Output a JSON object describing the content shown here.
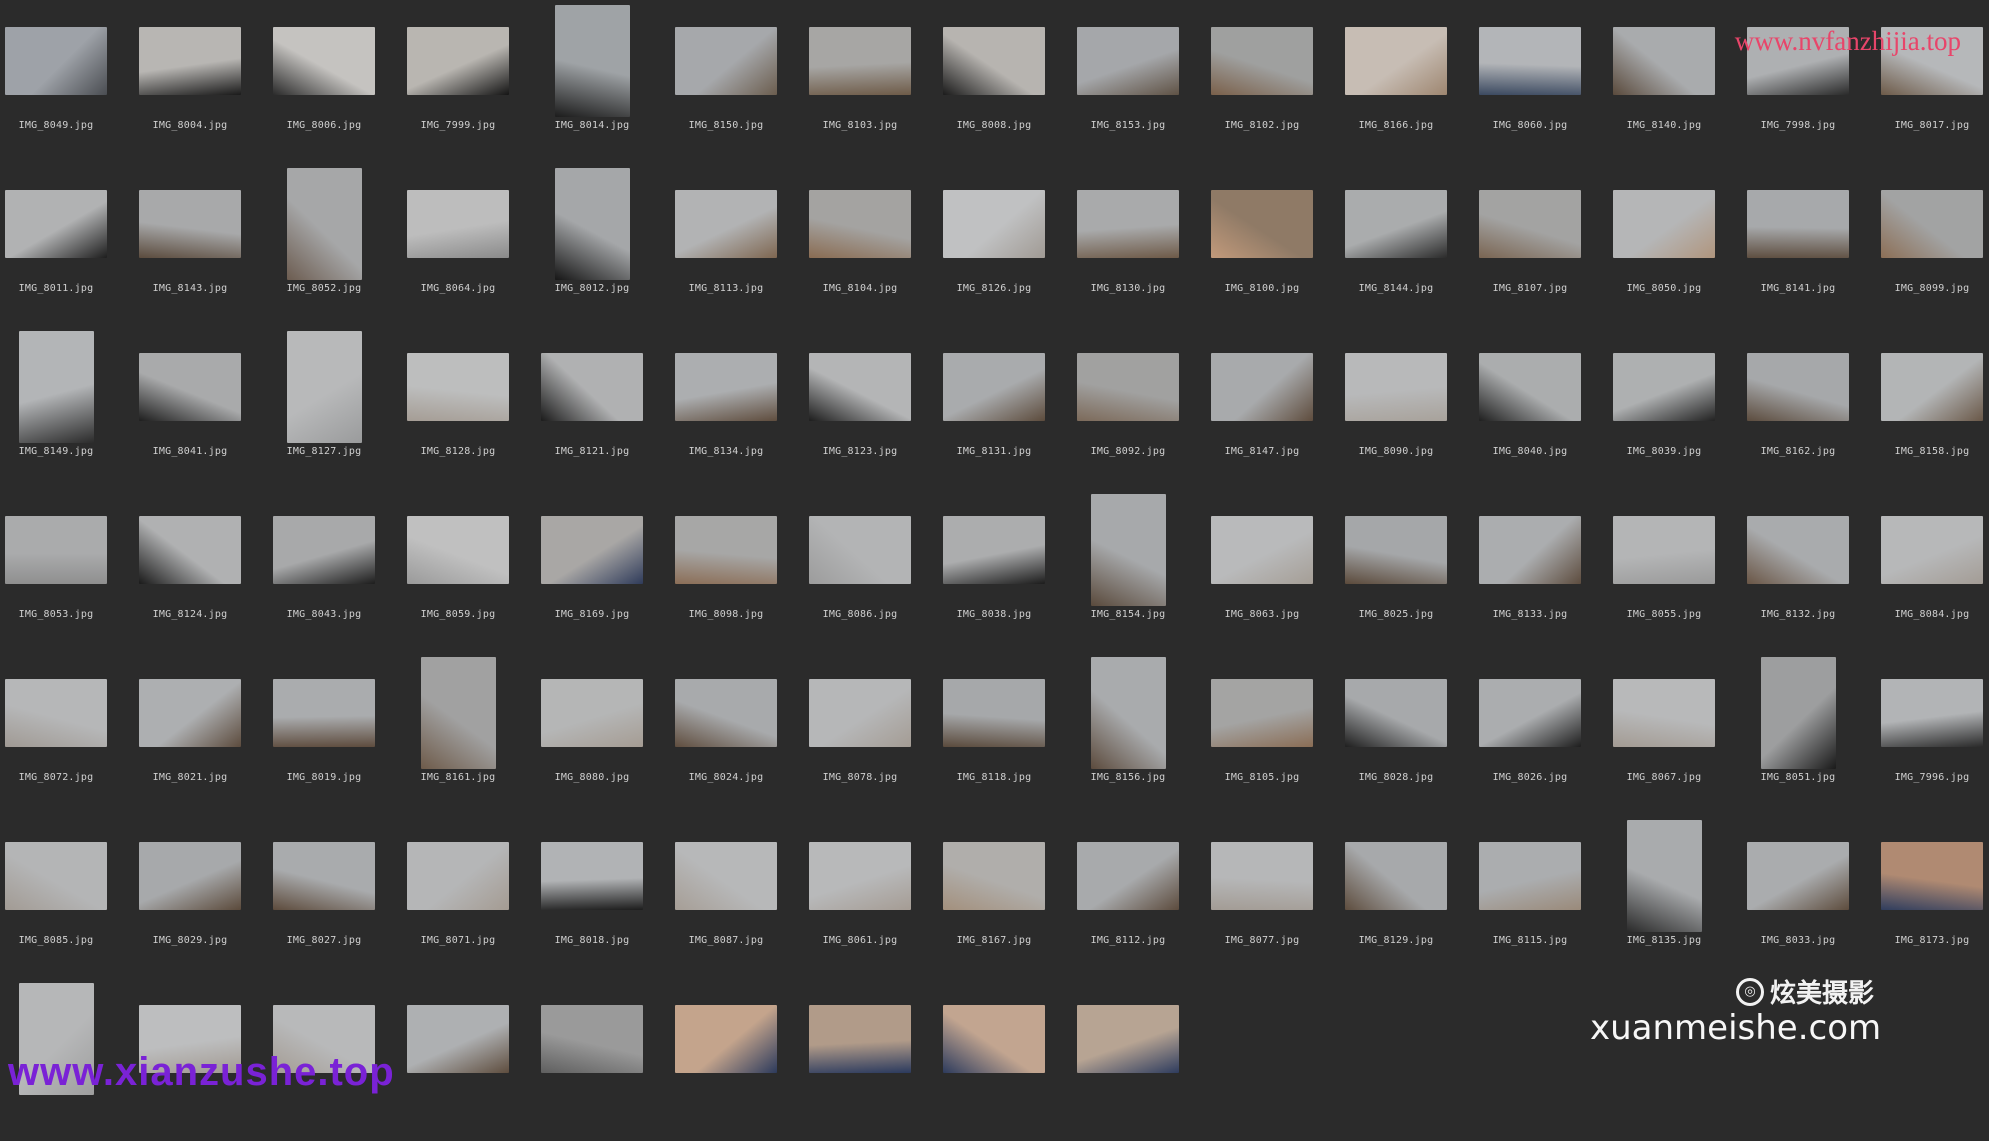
{
  "files": [
    {
      "name": "IMG_8049.jpg",
      "o": "l",
      "c": [
        "#9ea2a8",
        "#4a4d52"
      ]
    },
    {
      "name": "IMG_8004.jpg",
      "o": "l",
      "c": [
        "#b8b6b3",
        "#1a1a1a"
      ]
    },
    {
      "name": "IMG_8006.jpg",
      "o": "l",
      "c": [
        "#c5c3c0",
        "#2a2a2a"
      ]
    },
    {
      "name": "IMG_7999.jpg",
      "o": "l",
      "c": [
        "#b9b6b1",
        "#151515"
      ]
    },
    {
      "name": "IMG_8014.jpg",
      "o": "p",
      "c": [
        "#9fa3a6",
        "#1c1c1c"
      ]
    },
    {
      "name": "IMG_8150.jpg",
      "o": "l",
      "c": [
        "#a6a8ab",
        "#6b5d4e"
      ]
    },
    {
      "name": "IMG_8103.jpg",
      "o": "l",
      "c": [
        "#a7a6a4",
        "#6e5b48"
      ]
    },
    {
      "name": "IMG_8008.jpg",
      "o": "l",
      "c": [
        "#b7b4b0",
        "#1b1b1b"
      ]
    },
    {
      "name": "IMG_8153.jpg",
      "o": "l",
      "c": [
        "#a5a7aa",
        "#5f5245"
      ]
    },
    {
      "name": "IMG_8102.jpg",
      "o": "l",
      "c": [
        "#9fa09f",
        "#7a604a"
      ]
    },
    {
      "name": "IMG_8166.jpg",
      "o": "l",
      "c": [
        "#c7bdb4",
        "#9e8670"
      ]
    },
    {
      "name": "IMG_8060.jpg",
      "o": "l",
      "c": [
        "#b3b5b8",
        "#3b4960"
      ]
    },
    {
      "name": "IMG_8140.jpg",
      "o": "l",
      "c": [
        "#a9abad",
        "#5a4a3c"
      ]
    },
    {
      "name": "IMG_7998.jpg",
      "o": "l",
      "c": [
        "#aeb0b2",
        "#2a2a2a"
      ]
    },
    {
      "name": "IMG_8017.jpg",
      "o": "l",
      "c": [
        "#b6b8ba",
        "#6d5a48"
      ]
    },
    {
      "name": "IMG_8011.jpg",
      "o": "l",
      "c": [
        "#b1b2b3",
        "#1e1e1e"
      ]
    },
    {
      "name": "IMG_8143.jpg",
      "o": "l",
      "c": [
        "#a8a9aa",
        "#5b4b3d"
      ]
    },
    {
      "name": "IMG_8052.jpg",
      "o": "p",
      "c": [
        "#a6a7a8",
        "#6c5c50"
      ]
    },
    {
      "name": "IMG_8064.jpg",
      "o": "l",
      "c": [
        "#bdbdbd",
        "#8a8a8a"
      ]
    },
    {
      "name": "IMG_8012.jpg",
      "o": "p",
      "c": [
        "#a5a7a9",
        "#161616"
      ]
    },
    {
      "name": "IMG_8113.jpg",
      "o": "l",
      "c": [
        "#b2b3b4",
        "#7e6650"
      ]
    },
    {
      "name": "IMG_8104.jpg",
      "o": "l",
      "c": [
        "#a4a3a1",
        "#8a6c52"
      ]
    },
    {
      "name": "IMG_8126.jpg",
      "o": "l",
      "c": [
        "#c0c1c2",
        "#a09a94"
      ]
    },
    {
      "name": "IMG_8130.jpg",
      "o": "l",
      "c": [
        "#a9aaab",
        "#6e5a48"
      ]
    },
    {
      "name": "IMG_8100.jpg",
      "o": "l",
      "c": [
        "#8f7a66",
        "#c29a7b"
      ]
    },
    {
      "name": "IMG_8144.jpg",
      "o": "l",
      "c": [
        "#aaacad",
        "#2b2b2b"
      ]
    },
    {
      "name": "IMG_8107.jpg",
      "o": "l",
      "c": [
        "#a3a3a2",
        "#7a6552"
      ]
    },
    {
      "name": "IMG_8050.jpg",
      "o": "l",
      "c": [
        "#b5b6b7",
        "#b0957d"
      ]
    },
    {
      "name": "IMG_8141.jpg",
      "o": "l",
      "c": [
        "#a7a9ab",
        "#5e4e40"
      ]
    },
    {
      "name": "IMG_8099.jpg",
      "o": "l",
      "c": [
        "#a2a3a3",
        "#8c6f56"
      ]
    },
    {
      "name": "IMG_8149.jpg",
      "o": "p",
      "c": [
        "#b3b5b7",
        "#2b2b2b"
      ]
    },
    {
      "name": "IMG_8041.jpg",
      "o": "l",
      "c": [
        "#a9aaab",
        "#1e1e1e"
      ]
    },
    {
      "name": "IMG_8127.jpg",
      "o": "p",
      "c": [
        "#b8b9ba",
        "#9a9b9c"
      ]
    },
    {
      "name": "IMG_8128.jpg",
      "o": "l",
      "c": [
        "#bdbebe",
        "#a59d95"
      ]
    },
    {
      "name": "IMG_8121.jpg",
      "o": "l",
      "c": [
        "#b0b1b2",
        "#1b1b1b"
      ]
    },
    {
      "name": "IMG_8134.jpg",
      "o": "l",
      "c": [
        "#acaeb0",
        "#5f4d3e"
      ]
    },
    {
      "name": "IMG_8123.jpg",
      "o": "l",
      "c": [
        "#b4b5b6",
        "#1d1d1d"
      ]
    },
    {
      "name": "IMG_8131.jpg",
      "o": "l",
      "c": [
        "#a9abad",
        "#5c4b3c"
      ]
    },
    {
      "name": "IMG_8092.jpg",
      "o": "l",
      "c": [
        "#a1a1a0",
        "#7c6a5a"
      ]
    },
    {
      "name": "IMG_8147.jpg",
      "o": "l",
      "c": [
        "#a8aaac",
        "#5e4c3d"
      ]
    },
    {
      "name": "IMG_8090.jpg",
      "o": "l",
      "c": [
        "#b8b9ba",
        "#a8a29b"
      ]
    },
    {
      "name": "IMG_8040.jpg",
      "o": "l",
      "c": [
        "#abadae",
        "#1f1f1f"
      ]
    },
    {
      "name": "IMG_8039.jpg",
      "o": "l",
      "c": [
        "#aeb0b1",
        "#222222"
      ]
    },
    {
      "name": "IMG_8162.jpg",
      "o": "l",
      "c": [
        "#a6a8aa",
        "#5c4c3e"
      ]
    },
    {
      "name": "IMG_8158.jpg",
      "o": "l",
      "c": [
        "#b3b5b6",
        "#6a5848"
      ]
    },
    {
      "name": "IMG_8053.jpg",
      "o": "l",
      "c": [
        "#aaabac",
        "#8f8f8f"
      ]
    },
    {
      "name": "IMG_8124.jpg",
      "o": "l",
      "c": [
        "#b0b1b2",
        "#1a1a1a"
      ]
    },
    {
      "name": "IMG_8043.jpg",
      "o": "l",
      "c": [
        "#a8a9aa",
        "#1d1d1d"
      ]
    },
    {
      "name": "IMG_8059.jpg",
      "o": "l",
      "c": [
        "#c0c0c0",
        "#9a9a9a"
      ]
    },
    {
      "name": "IMG_8169.jpg",
      "o": "l",
      "c": [
        "#a9a7a5",
        "#2f3b5a"
      ]
    },
    {
      "name": "IMG_8098.jpg",
      "o": "l",
      "c": [
        "#a7a7a6",
        "#8b6e57"
      ]
    },
    {
      "name": "IMG_8086.jpg",
      "o": "l",
      "c": [
        "#b3b4b5",
        "#9c9c9c"
      ]
    },
    {
      "name": "IMG_8038.jpg",
      "o": "l",
      "c": [
        "#acadae",
        "#1c1c1c"
      ]
    },
    {
      "name": "IMG_8154.jpg",
      "o": "p",
      "c": [
        "#a7a9ab",
        "#5a4a3c"
      ]
    },
    {
      "name": "IMG_8063.jpg",
      "o": "l",
      "c": [
        "#b9babb",
        "#a59e96"
      ]
    },
    {
      "name": "IMG_8025.jpg",
      "o": "l",
      "c": [
        "#a5a7a9",
        "#5b4a3b"
      ]
    },
    {
      "name": "IMG_8133.jpg",
      "o": "l",
      "c": [
        "#abadaf",
        "#5d4c3e"
      ]
    },
    {
      "name": "IMG_8055.jpg",
      "o": "l",
      "c": [
        "#b4b5b6",
        "#9a9a9a"
      ]
    },
    {
      "name": "IMG_8132.jpg",
      "o": "l",
      "c": [
        "#a9abad",
        "#6a5646"
      ]
    },
    {
      "name": "IMG_8084.jpg",
      "o": "l",
      "c": [
        "#b7b8b9",
        "#a39c95"
      ]
    },
    {
      "name": "IMG_8072.jpg",
      "o": "l",
      "c": [
        "#b6b7b8",
        "#a09a94"
      ]
    },
    {
      "name": "IMG_8021.jpg",
      "o": "l",
      "c": [
        "#adafb1",
        "#5c4b3d"
      ]
    },
    {
      "name": "IMG_8019.jpg",
      "o": "l",
      "c": [
        "#aaacae",
        "#5e4c3e"
      ]
    },
    {
      "name": "IMG_8161.jpg",
      "o": "p",
      "c": [
        "#a1a1a1",
        "#6e5b4a"
      ]
    },
    {
      "name": "IMG_8080.jpg",
      "o": "l",
      "c": [
        "#b5b6b6",
        "#a59c93"
      ]
    },
    {
      "name": "IMG_8024.jpg",
      "o": "l",
      "c": [
        "#a8aaac",
        "#5f4d3e"
      ]
    },
    {
      "name": "IMG_8078.jpg",
      "o": "l",
      "c": [
        "#b6b7b8",
        "#a49c94"
      ]
    },
    {
      "name": "IMG_8118.jpg",
      "o": "l",
      "c": [
        "#a6a8aa",
        "#5a4a3c"
      ]
    },
    {
      "name": "IMG_8156.jpg",
      "o": "p",
      "c": [
        "#a9abad",
        "#5c4b3d"
      ]
    },
    {
      "name": "IMG_8105.jpg",
      "o": "l",
      "c": [
        "#a4a4a3",
        "#8a6d55"
      ]
    },
    {
      "name": "IMG_8028.jpg",
      "o": "l",
      "c": [
        "#a7a9ab",
        "#1f1f1f"
      ]
    },
    {
      "name": "IMG_8026.jpg",
      "o": "l",
      "c": [
        "#abadaf",
        "#1e1e1e"
      ]
    },
    {
      "name": "IMG_8067.jpg",
      "o": "l",
      "c": [
        "#b8b9ba",
        "#a39b93"
      ]
    },
    {
      "name": "IMG_8051.jpg",
      "o": "p",
      "c": [
        "#9d9e9f",
        "#1a1a1a"
      ]
    },
    {
      "name": "IMG_7996.jpg",
      "o": "l",
      "c": [
        "#b2b4b6",
        "#2a2a2a"
      ]
    },
    {
      "name": "IMG_8085.jpg",
      "o": "l",
      "c": [
        "#b4b5b6",
        "#a29b94"
      ]
    },
    {
      "name": "IMG_8029.jpg",
      "o": "l",
      "c": [
        "#a7a9ab",
        "#5b4a3b"
      ]
    },
    {
      "name": "IMG_8027.jpg",
      "o": "l",
      "c": [
        "#a9abad",
        "#5d4b3c"
      ]
    },
    {
      "name": "IMG_8071.jpg",
      "o": "l",
      "c": [
        "#b5b6b7",
        "#a49b92"
      ]
    },
    {
      "name": "IMG_8018.jpg",
      "o": "l",
      "c": [
        "#b1b3b5",
        "#1d1d1d"
      ]
    },
    {
      "name": "IMG_8087.jpg",
      "o": "l",
      "c": [
        "#b7b8b9",
        "#a69e96"
      ]
    },
    {
      "name": "IMG_8061.jpg",
      "o": "l",
      "c": [
        "#b8b9ba",
        "#a59c94"
      ]
    },
    {
      "name": "IMG_8167.jpg",
      "o": "l",
      "c": [
        "#b0aeab",
        "#a3907d"
      ]
    },
    {
      "name": "IMG_8112.jpg",
      "o": "l",
      "c": [
        "#a8aaac",
        "#5c4b3d"
      ]
    },
    {
      "name": "IMG_8077.jpg",
      "o": "l",
      "c": [
        "#b6b7b8",
        "#a39c95"
      ]
    },
    {
      "name": "IMG_8129.jpg",
      "o": "l",
      "c": [
        "#a7a9ab",
        "#5e4d3e"
      ]
    },
    {
      "name": "IMG_8115.jpg",
      "o": "l",
      "c": [
        "#abadaf",
        "#9a8a7a"
      ]
    },
    {
      "name": "IMG_8135.jpg",
      "o": "p",
      "c": [
        "#a9abad",
        "#2a2a2a"
      ]
    },
    {
      "name": "IMG_8033.jpg",
      "o": "l",
      "c": [
        "#aaacae",
        "#5d4c3d"
      ]
    },
    {
      "name": "IMG_8173.jpg",
      "o": "l",
      "c": [
        "#b08a72",
        "#2f3d5e"
      ]
    },
    {
      "name": "",
      "o": "p",
      "c": [
        "#b6b7b8",
        "#9e9e9e"
      ]
    },
    {
      "name": "",
      "o": "l",
      "c": [
        "#bdbebf",
        "#a29a92"
      ]
    },
    {
      "name": "",
      "o": "l",
      "c": [
        "#b8b9ba",
        "#a49c94"
      ]
    },
    {
      "name": "",
      "o": "l",
      "c": [
        "#aeb0b2",
        "#5e4d3e"
      ]
    },
    {
      "name": "",
      "o": "l",
      "c": [
        "#9a9a9a",
        "#5f5f5f"
      ]
    },
    {
      "name": "",
      "o": "l",
      "c": [
        "#c4a48c",
        "#2c3a5c"
      ]
    },
    {
      "name": "",
      "o": "l",
      "c": [
        "#b19b89",
        "#2b3a5e"
      ]
    },
    {
      "name": "",
      "o": "l",
      "c": [
        "#c2a590",
        "#2d3b5d"
      ]
    },
    {
      "name": "",
      "o": "l",
      "c": [
        "#b7a493",
        "#2e3c5e"
      ]
    }
  ],
  "watermarks": {
    "top": "www.nvfanzhijia.top",
    "bottom": "www.xianzushe.top",
    "brand_logo": "◎",
    "brand_name": "炫美摄影",
    "brand_site": "xuanmeishe.com"
  }
}
